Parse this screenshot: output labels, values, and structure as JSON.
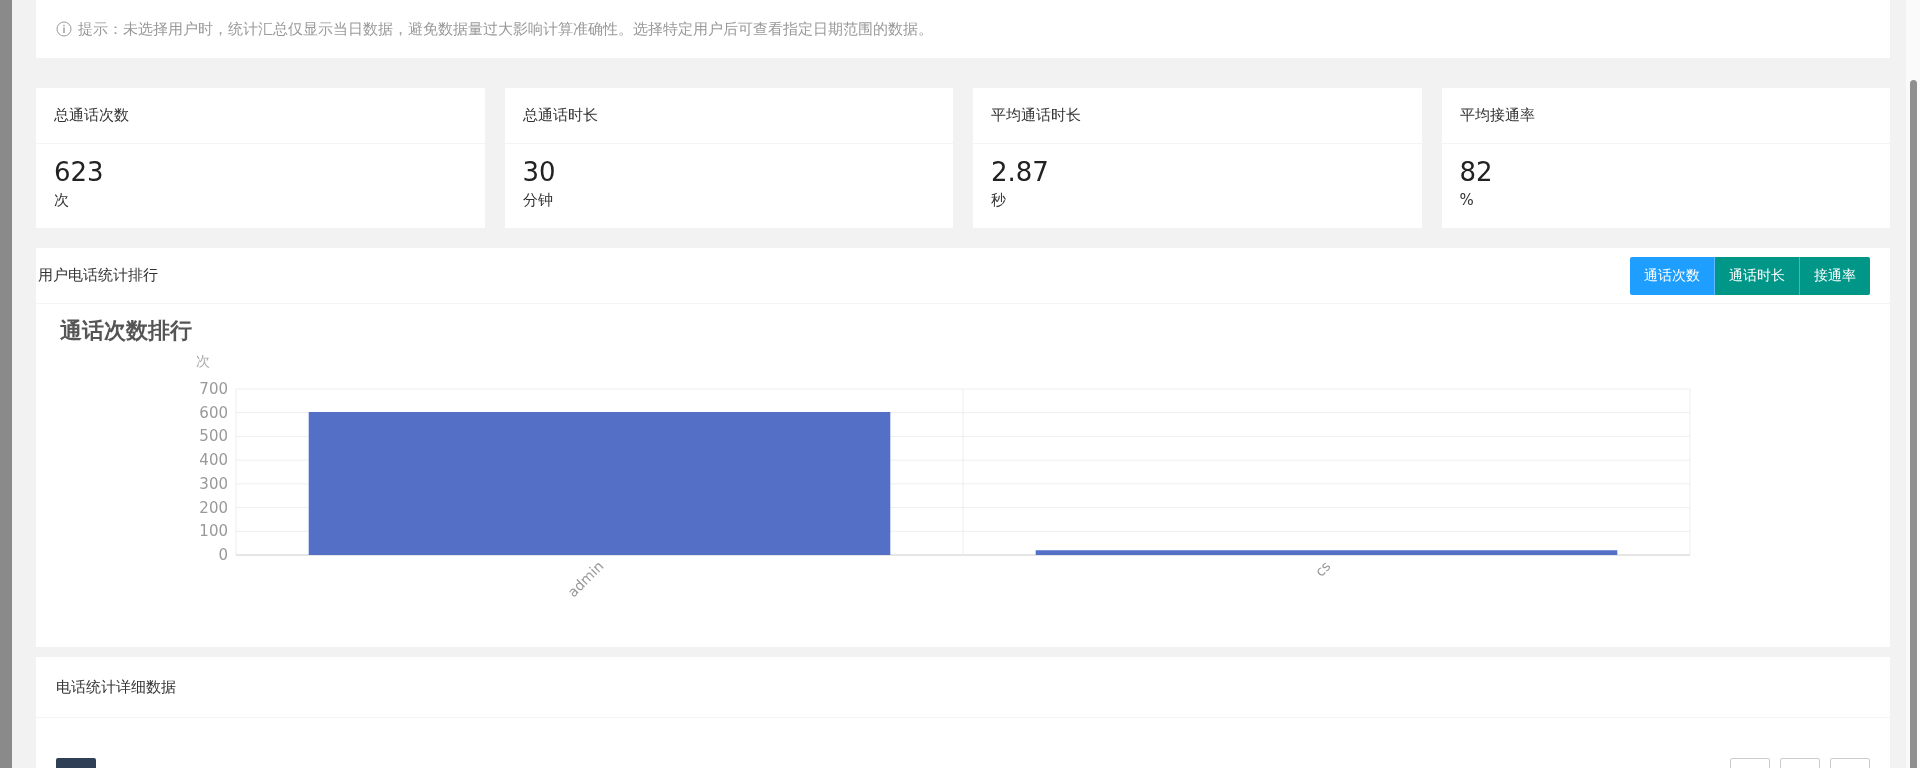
{
  "hint": {
    "text": "提示：未选择用户时，统计汇总仅显示当日数据，避免数据量过大影响计算准确性。选择特定用户后可查看指定日期范围的数据。"
  },
  "stats": [
    {
      "label": "总通话次数",
      "value": "623",
      "unit": "次"
    },
    {
      "label": "总通话时长",
      "value": "30",
      "unit": "分钟"
    },
    {
      "label": "平均通话时长",
      "value": "2.87",
      "unit": "秒"
    },
    {
      "label": "平均接通率",
      "value": "82",
      "unit": "%"
    }
  ],
  "ranking": {
    "title": "用户电话统计排行",
    "buttons": [
      {
        "label": "通话次数",
        "selected": true
      },
      {
        "label": "通话时长",
        "selected": false
      },
      {
        "label": "接通率",
        "selected": false
      }
    ],
    "chart_data": {
      "type": "bar",
      "title": "通话次数排行",
      "ylabel": "次",
      "categories": [
        "admin",
        "cs"
      ],
      "series": [
        {
          "color": "#5470c6",
          "values": [
            603,
            20
          ]
        }
      ],
      "grid": true,
      "ylim": [
        0,
        700
      ],
      "yticks": [
        0,
        100,
        200,
        300,
        400,
        500,
        600,
        700
      ]
    }
  },
  "details": {
    "title": "电话统计详细数据"
  }
}
